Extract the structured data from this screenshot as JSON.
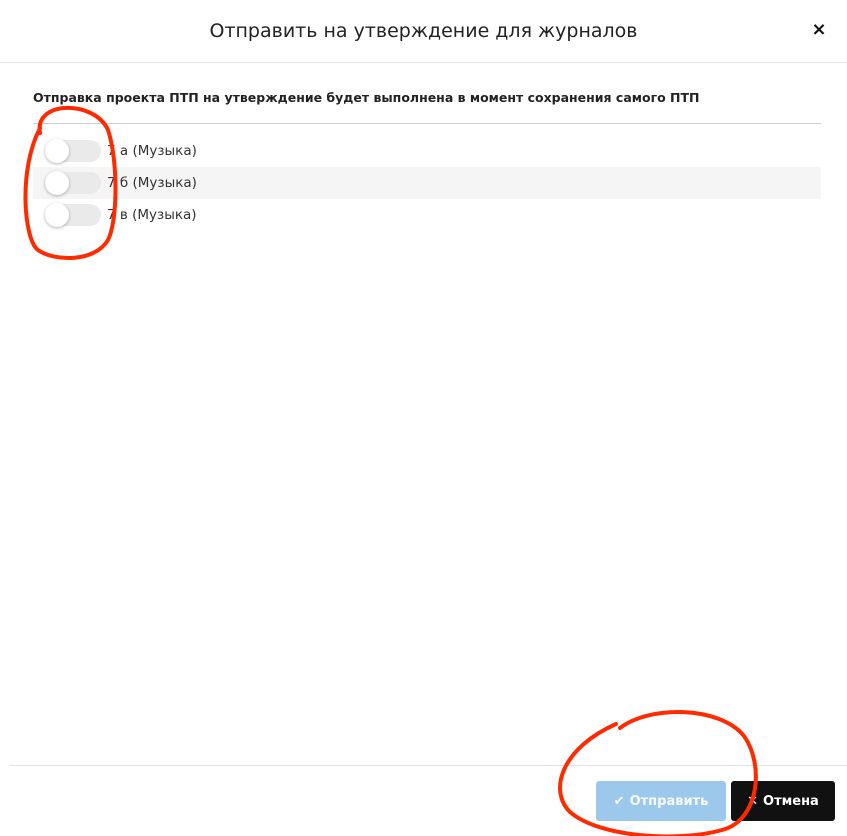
{
  "modal": {
    "title": "Отправить на утверждение для журналов",
    "close_glyph": "×",
    "notice": "Отправка проекта ПТП на утверждение будет выполнена в момент сохранения самого ПТП"
  },
  "journals": [
    {
      "label": "7 а (Музыка)",
      "enabled": false
    },
    {
      "label": "7 б (Музыка)",
      "enabled": false
    },
    {
      "label": "7 в (Музыка)",
      "enabled": false
    }
  ],
  "footer": {
    "send_label": "Отправить",
    "send_icon": "check-icon",
    "send_disabled": true,
    "cancel_label": "Отмена",
    "cancel_icon": "close-icon"
  },
  "annotations": {
    "color": "#ff2a00"
  }
}
